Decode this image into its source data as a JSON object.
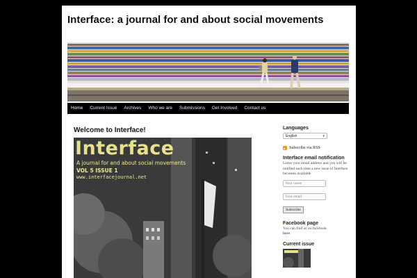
{
  "site": {
    "title": "Interface: a journal for and about social movements"
  },
  "nav": {
    "items": [
      "Home",
      "Current Issue",
      "Archives",
      "Who we are",
      "Submissions",
      "Get Involved",
      "Contact us"
    ]
  },
  "post": {
    "title": "Welcome to Interface!"
  },
  "cover": {
    "masthead": "Interface",
    "tagline": "A journal for and about social movements",
    "issue": "VOL 5 ISSUE 1",
    "url": "www.interfacejournal.net",
    "masthead_color": "#e9e18a"
  },
  "sidebar": {
    "languages": {
      "title": "Languages",
      "selected": "English"
    },
    "rss": {
      "label": "Subscribe via RSS"
    },
    "email": {
      "title": "Interface email notification",
      "desc": "Leave your email address and you will be notified each time a new issue of Interface becomes available",
      "name_placeholder": "Your name",
      "email_placeholder": "Your email",
      "button": "Subscribe"
    },
    "facebook": {
      "title": "Facebook page",
      "text": "You can find us on facebook",
      "link": "here"
    },
    "current_issue": {
      "title": "Current issue"
    }
  },
  "colors": {
    "background": "#000000",
    "rss": "#f39a1b",
    "link": "#1b74c5"
  }
}
